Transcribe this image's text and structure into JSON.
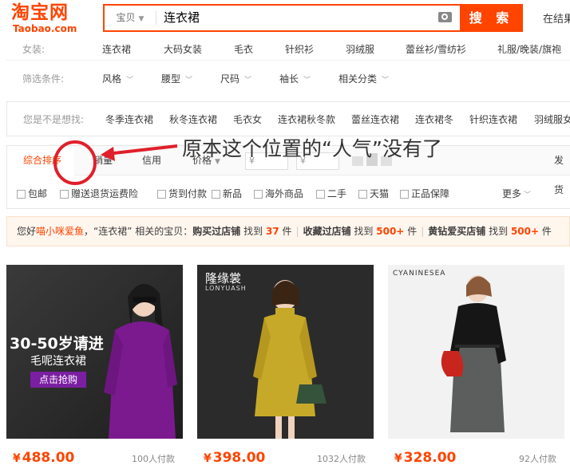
{
  "header": {
    "logo_cn": "淘宝网",
    "logo_en": "Taobao.com",
    "search_type": "宝贝",
    "search_value": "连衣裙",
    "search_button": "搜 索",
    "in_results": "在结果"
  },
  "nav1": {
    "label": "女装:",
    "items": [
      "连衣裙",
      "大码女装",
      "毛衣",
      "针织衫",
      "羽绒服",
      "蕾丝衫/雪纺衫",
      "礼服/晚装/旗袍"
    ]
  },
  "nav2": {
    "label": "筛选条件:",
    "items": [
      "风格",
      "腰型",
      "尺码",
      "袖长",
      "相关分类"
    ]
  },
  "suggest": {
    "label": "您是不是想找:",
    "items": [
      "冬季连衣裙",
      "秋冬连衣裙",
      "毛衣女",
      "连衣裙秋冬款",
      "蕾丝连衣裙",
      "连衣裙冬",
      "针织连衣裙",
      "羽绒服女"
    ]
  },
  "sort": {
    "items": [
      "综合排序",
      "销量",
      "信用",
      "价格"
    ],
    "price_from": "¥",
    "price_to": "¥",
    "ship": "发货"
  },
  "filters": {
    "items": [
      "包邮",
      "赠送退货运费险",
      "货到付款",
      "新品",
      "海外商品",
      "二手",
      "天猫",
      "正品保障"
    ],
    "more": "更多"
  },
  "notice": {
    "hello": "您好",
    "user": "喵小咪爱鱼",
    "query": "，“连衣裙” 相关的宝贝：",
    "s1_label": "购买过店铺",
    "find": "找到",
    "s1_count": "37",
    "unit": "件",
    "sep": "|",
    "s2_label": "收藏过店铺",
    "s2_count": "500+",
    "s3_label": "黄钻爱买店铺",
    "s3_count": "500+"
  },
  "annotation": {
    "text": "原本这个位置的“人气”没有了"
  },
  "products": [
    {
      "price": "488.00",
      "sales": "100人付款",
      "img_text_1": "30-50岁请进",
      "img_text_2": "毛呢连衣裙",
      "img_text_3": "点击抢购"
    },
    {
      "price": "398.00",
      "sales": "1032人付款",
      "brand_cn": "隆缘裳",
      "brand_en": "LONYUASH"
    },
    {
      "price": "328.00",
      "sales": "92人付款",
      "brand_en": "CYANINESEA"
    }
  ],
  "currency": "¥",
  "colors": {
    "accent": "#ff4400",
    "annotation": "#e0202a"
  }
}
